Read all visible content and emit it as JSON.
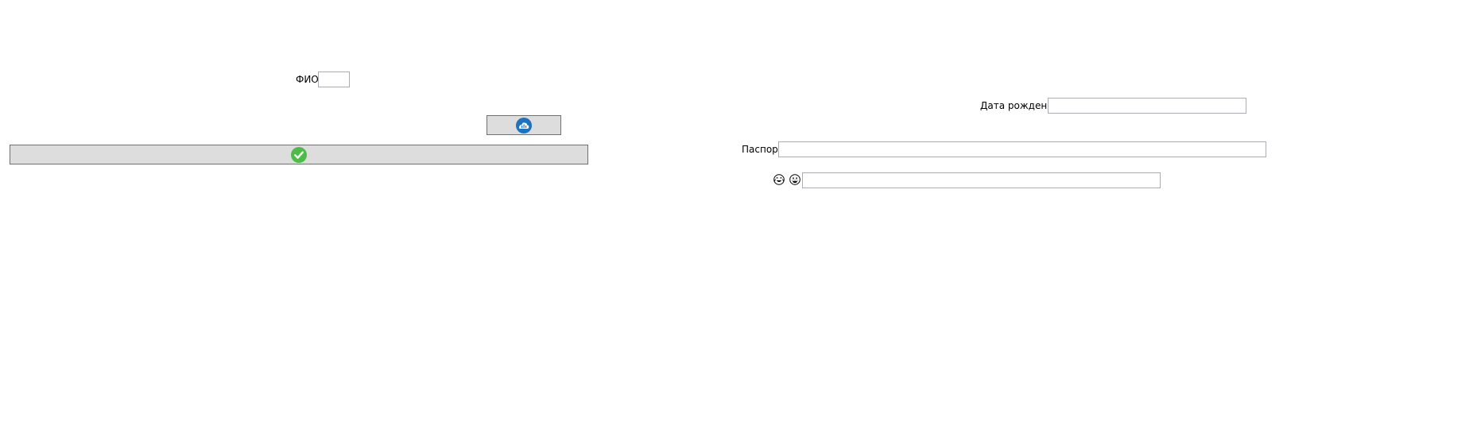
{
  "form": {
    "fio_label": "ФИО",
    "fio_value": "",
    "birthdate_label": "Дата рождения",
    "birthdate_value": "",
    "passport_label": "Паспорт",
    "passport_value": "",
    "emoji_field_value": ""
  },
  "buttons": {
    "cloud_button_icon": "cloud-icon",
    "confirm_button_icon": "checkmark-icon"
  },
  "colors": {
    "button_bg": "#dddddd",
    "button_border": "#707070",
    "input_border": "#abadb3",
    "cloud_blue": "#1e73be",
    "check_green": "#4cbb47"
  }
}
